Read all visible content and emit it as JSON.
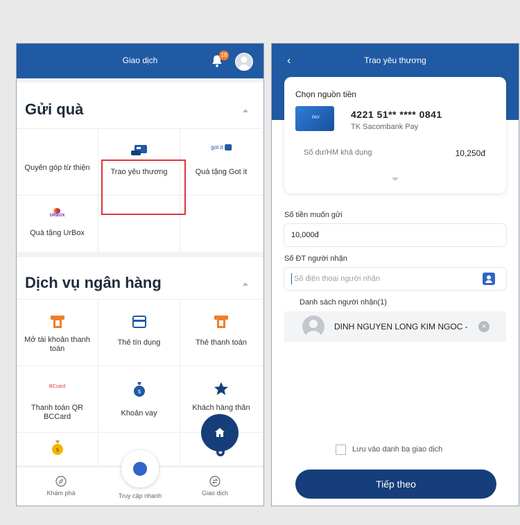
{
  "left": {
    "topbar": {
      "title": "Giao dịch",
      "notification_count": "18"
    },
    "gift_section": {
      "title": "Gửi quà",
      "items": [
        {
          "label": "Quyên góp từ thiện",
          "icon": "charity-icon"
        },
        {
          "label": "Trao yêu thương",
          "icon": "gift-card-icon"
        },
        {
          "label": "Quà tặng Got it",
          "icon": "got-it-icon",
          "logo_text": "got it"
        },
        {
          "label": "Quà tặng UrBox",
          "icon": "urbox-icon",
          "logo_text": "URBOX"
        }
      ]
    },
    "bank_section": {
      "title": "Dịch vụ ngân hàng",
      "items": [
        {
          "label": "Mở tài khoản thanh toán",
          "icon": "atm-icon"
        },
        {
          "label": "Thẻ tín dụng",
          "icon": "credit-card-icon"
        },
        {
          "label": "Thẻ thanh toán",
          "icon": "atm-card-icon"
        },
        {
          "label": "Thanh toán QR BCCard",
          "icon": "bccard-icon",
          "logo_text": "BCcard"
        },
        {
          "label": "Khoản vay",
          "icon": "money-bag-icon"
        },
        {
          "label": "Khách hàng thân",
          "icon": "star-icon"
        }
      ]
    },
    "bottomnav": {
      "explore": "Khám phá",
      "quick": "Truy cập nhanh",
      "transactions": "Giao dịch"
    }
  },
  "right": {
    "topbar": {
      "title": "Trao yêu thương"
    },
    "source": {
      "label": "Chọn nguồn tiền",
      "card_brand": "PAY",
      "account_number": "4221 51** **** 0841",
      "account_name": "TK Sacombank Pay",
      "balance_label": "Số dư/HM khả dụng",
      "balance_value": "10,250đ"
    },
    "amount": {
      "label": "Số tiền muốn gửi",
      "value": "10,000đ"
    },
    "phone": {
      "label": "Số ĐT người nhận",
      "placeholder": "Số điện thoại người nhận"
    },
    "recipients": {
      "label": "Danh sách người nhận(1)",
      "name": "DINH NGUYEN LONG KIM NGOC -"
    },
    "save_label": "Lưu vào danh bạ giao dịch",
    "next_label": "Tiếp theo"
  },
  "colors": {
    "primary": "#1f5aa3",
    "dark": "#163e7a",
    "accent": "#f07d2a",
    "highlight": "#e0333a"
  }
}
